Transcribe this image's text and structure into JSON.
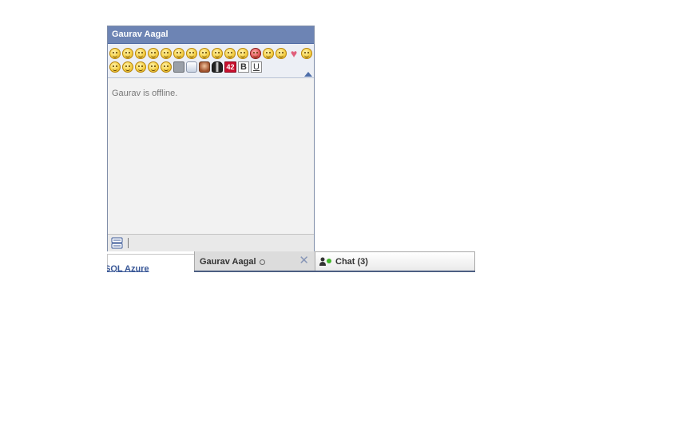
{
  "background": {
    "link_text": "SQL Azure"
  },
  "chat_window": {
    "title": "Gaurav Aagal",
    "status_message": "Gaurav is offline.",
    "formatting": {
      "bold_label": "B",
      "underline_label": "U"
    },
    "badge_number": "42"
  },
  "tabs": {
    "active_tab_name": "Gaurav Aagal",
    "close_symbol": "✕",
    "chat_label": "Chat",
    "chat_count": "(3)"
  },
  "colors": {
    "title_bar": "#6d84b4",
    "online": "#42b72a",
    "link": "#3b5998"
  }
}
